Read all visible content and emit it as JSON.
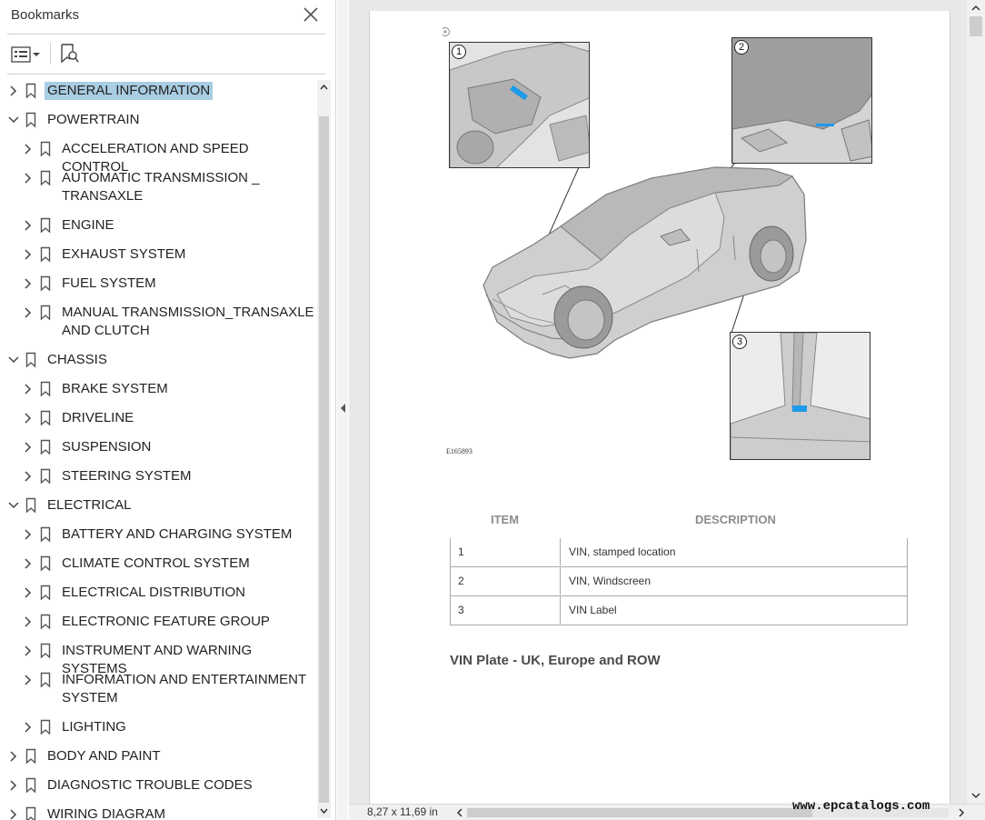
{
  "sidebar": {
    "title": "Bookmarks",
    "items": [
      {
        "label": "GENERAL INFORMATION",
        "expanded": false,
        "level": 0,
        "selected": true
      },
      {
        "label": "POWERTRAIN",
        "expanded": true,
        "level": 0
      },
      {
        "label": "ACCELERATION AND SPEED CONTROL",
        "expanded": false,
        "level": 1
      },
      {
        "label": "AUTOMATIC TRANSMISSION _\nTRANSAXLE",
        "expanded": false,
        "level": 1
      },
      {
        "label": "ENGINE",
        "expanded": false,
        "level": 1
      },
      {
        "label": "EXHAUST SYSTEM",
        "expanded": false,
        "level": 1
      },
      {
        "label": "FUEL SYSTEM",
        "expanded": false,
        "level": 1
      },
      {
        "label": "MANUAL TRANSMISSION_TRANSAXLE\nAND CLUTCH",
        "expanded": false,
        "level": 1
      },
      {
        "label": "CHASSIS",
        "expanded": true,
        "level": 0
      },
      {
        "label": "BRAKE SYSTEM",
        "expanded": false,
        "level": 1
      },
      {
        "label": "DRIVELINE",
        "expanded": false,
        "level": 1
      },
      {
        "label": "SUSPENSION",
        "expanded": false,
        "level": 1
      },
      {
        "label": "STEERING SYSTEM",
        "expanded": false,
        "level": 1
      },
      {
        "label": "ELECTRICAL",
        "expanded": true,
        "level": 0
      },
      {
        "label": "BATTERY AND CHARGING SYSTEM",
        "expanded": false,
        "level": 1
      },
      {
        "label": "CLIMATE CONTROL SYSTEM",
        "expanded": false,
        "level": 1
      },
      {
        "label": "ELECTRICAL DISTRIBUTION",
        "expanded": false,
        "level": 1
      },
      {
        "label": "ELECTRONIC FEATURE GROUP",
        "expanded": false,
        "level": 1
      },
      {
        "label": "INSTRUMENT AND WARNING SYSTEMS",
        "expanded": false,
        "level": 1
      },
      {
        "label": "INFORMATION AND ENTERTAINMENT\nSYSTEM",
        "expanded": false,
        "level": 1
      },
      {
        "label": "LIGHTING",
        "expanded": false,
        "level": 1
      },
      {
        "label": "BODY AND PAINT",
        "expanded": false,
        "level": 0
      },
      {
        "label": "DIAGNOSTIC TROUBLE CODES",
        "expanded": false,
        "level": 0
      },
      {
        "label": "WIRING DIAGRAM",
        "expanded": false,
        "level": 0
      }
    ]
  },
  "document": {
    "figure": {
      "callouts": [
        "1",
        "2",
        "3"
      ],
      "code": "E165893"
    },
    "table": {
      "headers": [
        "ITEM",
        "DESCRIPTION"
      ],
      "rows": [
        [
          "1",
          "VIN, stamped location"
        ],
        [
          "2",
          "VIN, Windscreen"
        ],
        [
          "3",
          "VIN Label"
        ]
      ]
    },
    "section_heading": "VIN Plate - UK, Europe and ROW"
  },
  "statusbar": {
    "page_size": "8,27 x 11,69 in",
    "watermark": "www.epcatalogs.com"
  },
  "colors": {
    "selection": "#a9cde3",
    "vin_highlight": "#1e9be8"
  }
}
